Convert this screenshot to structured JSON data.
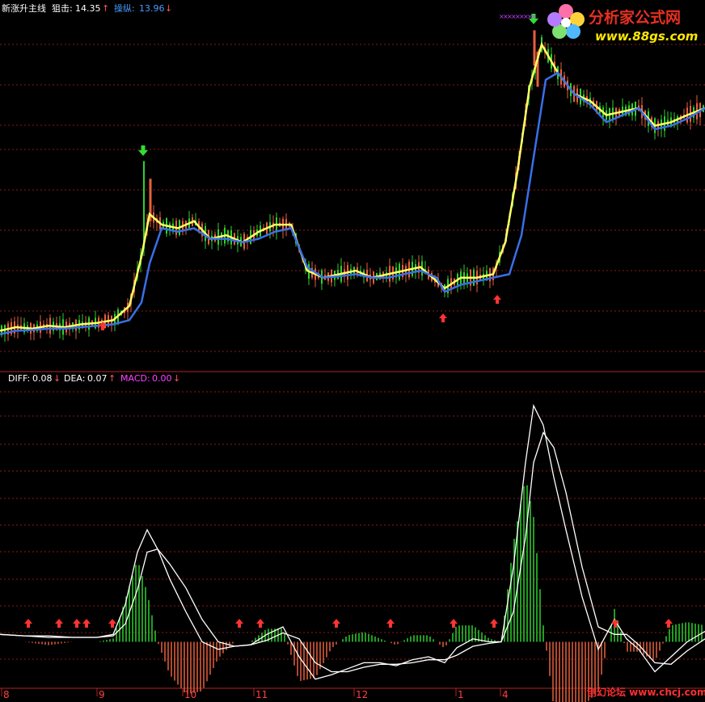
{
  "upper": {
    "indicator_name": "新涨升主线",
    "label1_name": "狙击:",
    "label1_value": "14.35",
    "label1_arrow": "↑",
    "label2_name": "操纵:",
    "label2_value": "13.96",
    "label2_arrow": "↓"
  },
  "lower": {
    "prefix": "",
    "diff_label": "DIFF:",
    "diff_value": "0.08",
    "diff_arrow": "↓",
    "dea_label": "DEA:",
    "dea_value": "0.07",
    "dea_arrow": "↑",
    "macd_label": "MACD:",
    "macd_value": "0.00",
    "macd_arrow": "↓"
  },
  "watermark_top": {
    "title": "分析家公式网",
    "url": "www.88gs.com"
  },
  "watermark_bottom": "创幻论坛 www.chcj.com",
  "colors": {
    "grid": "#8b1a1a",
    "line_yellow": "#ffff66",
    "line_blue": "#3a6fe8",
    "bar_up": "#2ed12e",
    "bar_down": "#e8603c",
    "macd_line": "#ffffff",
    "arrow_up": "#ff3333",
    "arrow_down": "#33dd33",
    "label_white": "#ffffff",
    "label_blue": "#4a9bff",
    "label_magenta": "#ff44ff"
  },
  "chart_data": {
    "type": "line",
    "x_axis_labels": [
      "8",
      "9",
      "10",
      "11",
      "12",
      "1",
      "4"
    ],
    "series": [
      {
        "name": "狙击",
        "color": "yellow",
        "x": [
          0,
          20,
          40,
          60,
          80,
          100,
          120,
          140,
          160,
          175,
          185,
          200,
          220,
          240,
          260,
          280,
          300,
          320,
          340,
          360,
          380,
          400,
          420,
          440,
          460,
          480,
          500,
          520,
          540,
          550,
          570,
          590,
          610,
          625,
          640,
          655,
          670,
          690,
          710,
          730,
          750,
          770,
          790,
          810,
          830,
          850,
          872
        ],
        "values": [
          10.55,
          10.6,
          10.58,
          10.62,
          10.6,
          10.64,
          10.66,
          10.7,
          10.9,
          11.6,
          12.2,
          12.05,
          12.0,
          12.1,
          11.85,
          11.9,
          11.8,
          11.95,
          12.05,
          12.05,
          11.4,
          11.3,
          11.35,
          11.4,
          11.3,
          11.35,
          11.4,
          11.45,
          11.25,
          11.15,
          11.3,
          11.3,
          11.35,
          11.8,
          12.8,
          14.0,
          14.6,
          14.2,
          13.9,
          13.8,
          13.6,
          13.65,
          13.7,
          13.45,
          13.5,
          13.6,
          13.7
        ]
      },
      {
        "name": "操纵",
        "color": "blue",
        "x": [
          0,
          20,
          40,
          60,
          80,
          100,
          120,
          140,
          160,
          175,
          185,
          200,
          220,
          240,
          260,
          280,
          300,
          320,
          340,
          360,
          380,
          400,
          420,
          440,
          460,
          480,
          500,
          520,
          540,
          550,
          570,
          590,
          610,
          630,
          645,
          660,
          675,
          690,
          710,
          730,
          750,
          770,
          790,
          810,
          830,
          850,
          872
        ],
        "values": [
          10.5,
          10.55,
          10.56,
          10.58,
          10.58,
          10.6,
          10.62,
          10.64,
          10.7,
          10.95,
          11.5,
          12.0,
          11.95,
          12.0,
          11.85,
          11.85,
          11.8,
          11.85,
          11.95,
          12.0,
          11.45,
          11.3,
          11.32,
          11.35,
          11.3,
          11.3,
          11.35,
          11.4,
          11.3,
          11.1,
          11.2,
          11.25,
          11.3,
          11.35,
          11.9,
          13.0,
          14.1,
          14.2,
          13.9,
          13.75,
          13.5,
          13.6,
          13.7,
          13.4,
          13.45,
          13.55,
          13.7
        ]
      }
    ],
    "macd": {
      "x": [
        0,
        30,
        60,
        90,
        120,
        140,
        155,
        170,
        182,
        195,
        210,
        230,
        250,
        270,
        290,
        310,
        330,
        350,
        370,
        390,
        410,
        430,
        450,
        470,
        490,
        510,
        530,
        550,
        565,
        585,
        605,
        620,
        635,
        650,
        660,
        672,
        685,
        700,
        720,
        740,
        760,
        775,
        790,
        810,
        830,
        850,
        872
      ],
      "diff": [
        0.05,
        0.04,
        0.03,
        0.03,
        0.03,
        0.05,
        0.25,
        0.6,
        0.75,
        0.62,
        0.42,
        0.2,
        0.0,
        -0.05,
        -0.03,
        -0.02,
        0.05,
        0.1,
        -0.1,
        -0.25,
        -0.22,
        -0.18,
        -0.14,
        -0.14,
        -0.16,
        -0.12,
        -0.1,
        -0.14,
        -0.04,
        0.02,
        0.0,
        0.0,
        0.5,
        1.2,
        1.58,
        1.45,
        1.1,
        0.75,
        0.3,
        -0.05,
        0.15,
        0.02,
        -0.05,
        -0.2,
        -0.1,
        0.0,
        0.07
      ],
      "dea": [
        0.05,
        0.04,
        0.04,
        0.03,
        0.03,
        0.04,
        0.12,
        0.35,
        0.6,
        0.62,
        0.52,
        0.36,
        0.15,
        0.0,
        -0.03,
        -0.02,
        0.01,
        0.06,
        0.02,
        -0.14,
        -0.2,
        -0.2,
        -0.17,
        -0.15,
        -0.15,
        -0.14,
        -0.12,
        -0.12,
        -0.09,
        -0.03,
        -0.01,
        0.0,
        0.2,
        0.7,
        1.2,
        1.4,
        1.3,
        1.0,
        0.5,
        0.1,
        0.05,
        0.05,
        -0.02,
        -0.14,
        -0.15,
        -0.06,
        0.02
      ],
      "ylim": [
        -0.3,
        1.7
      ]
    },
    "ylim_price": [
      10.2,
      15.0
    ]
  }
}
